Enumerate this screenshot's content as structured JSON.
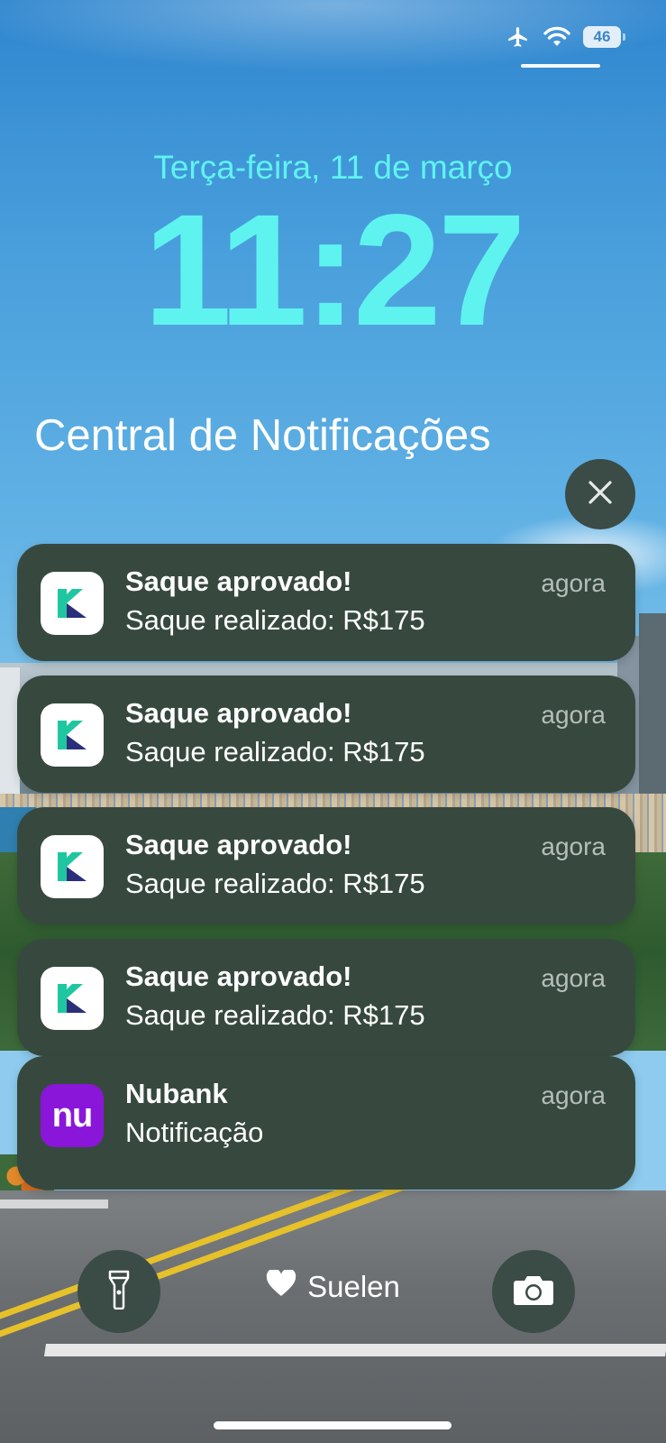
{
  "status_bar": {
    "airplane_icon": "airplane-icon",
    "wifi_icon": "wifi-icon",
    "battery_level": "46"
  },
  "lock_screen": {
    "date": "Terça-feira, 11 de março",
    "time": "11:27",
    "clock_color": "#5ff3f0"
  },
  "notification_center": {
    "title": "Central de Notificações",
    "clear_icon": "close-icon"
  },
  "notifications": [
    {
      "app": "K app",
      "title": "Saque aprovado!",
      "body": "Saque realizado: R$175",
      "time": "agora"
    },
    {
      "app": "K app",
      "title": "Saque aprovado!",
      "body": "Saque realizado: R$175",
      "time": "agora"
    },
    {
      "app": "K app",
      "title": "Saque aprovado!",
      "body": "Saque realizado: R$175",
      "time": "agora"
    },
    {
      "app": "K app",
      "title": "Saque aprovado!",
      "body": "Saque realizado: R$175",
      "time": "agora"
    },
    {
      "app": "Nubank",
      "title": "Nubank",
      "body": "Notificação",
      "time": "agora",
      "icon_text": "nu"
    }
  ],
  "bottom": {
    "owner_name": "Suelen",
    "flashlight_icon": "flashlight-icon",
    "camera_icon": "camera-icon",
    "heart_icon": "heart-icon"
  },
  "colors": {
    "notification_bg": "#37493f",
    "nubank_purple": "#8a16d9",
    "k_green": "#1fc7a0",
    "k_navy": "#2b2f7a"
  }
}
